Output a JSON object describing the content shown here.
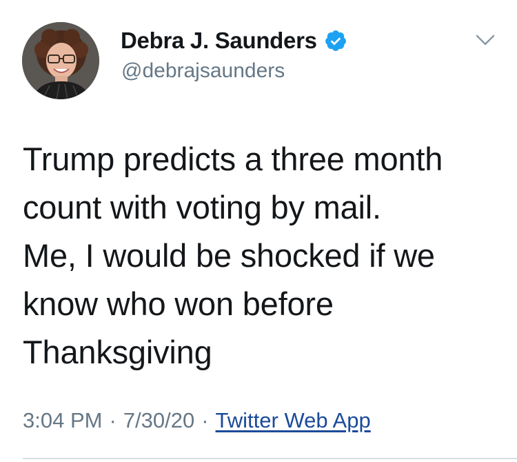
{
  "author": {
    "display_name": "Debra J. Saunders",
    "handle": "@debrajsaunders",
    "verified": true
  },
  "tweet": {
    "text": "Trump predicts a three month\ncount with voting by mail.\nMe, I would be shocked if we\nknow who won before\nThanksgiving",
    "time": "3:04 PM",
    "date": "7/30/20",
    "separator": "·",
    "source": "Twitter Web App"
  },
  "icons": {
    "verified": "verified-badge-icon",
    "menu": "chevron-down-icon"
  },
  "colors": {
    "verified_blue": "#1da1f2",
    "secondary_text": "#657786",
    "link": "#1b4a9a"
  }
}
